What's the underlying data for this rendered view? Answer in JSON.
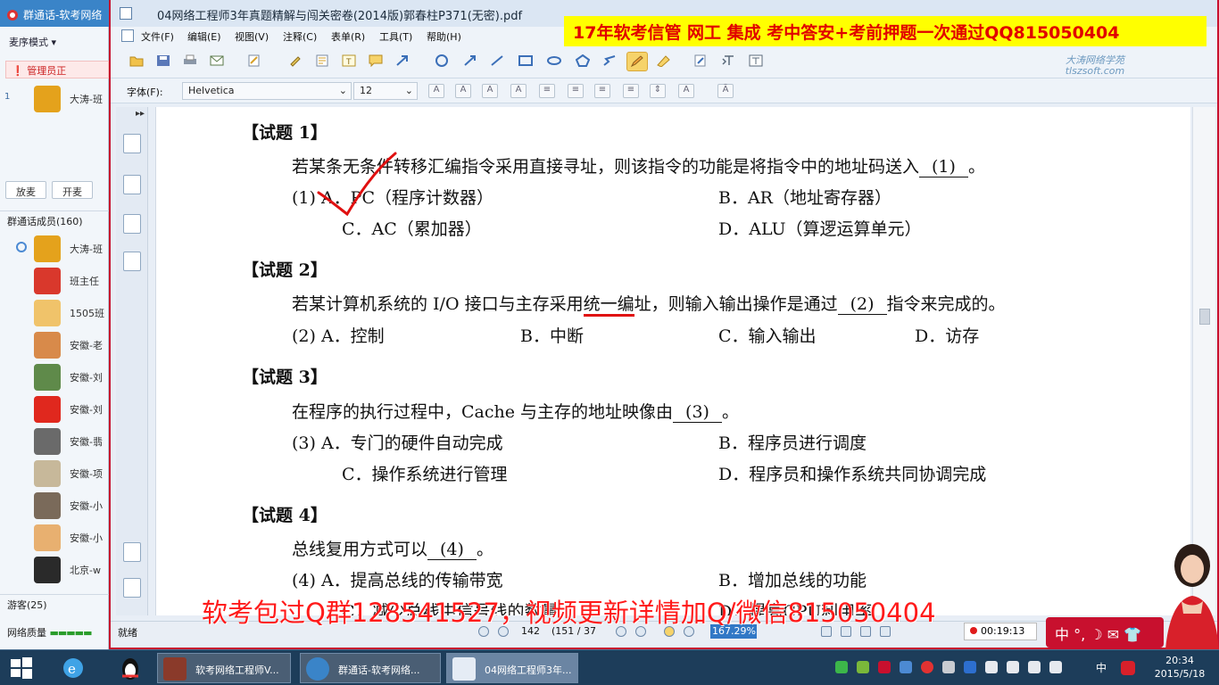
{
  "chat": {
    "title": "群通话-软考网络",
    "mode_label": "麦序模式",
    "admin_label": "管理员正",
    "top_user": {
      "index": "1",
      "name": "大涛-班"
    },
    "buttons": {
      "release": "放麦",
      "open": "开麦"
    },
    "members_label": "群通话成员(160)",
    "members": [
      {
        "name": "大涛-班"
      },
      {
        "name": "班主任"
      },
      {
        "name": "1505班"
      },
      {
        "name": "安徽-老"
      },
      {
        "name": "安徽-刘"
      },
      {
        "name": "安徽-刘"
      },
      {
        "name": "安徽-翡"
      },
      {
        "name": "安徽-项"
      },
      {
        "name": "安徽-小"
      },
      {
        "name": "安徽-小"
      },
      {
        "name": "北京-w"
      }
    ],
    "guests_label": "游客(25)",
    "network_label": "网络质量",
    "network_bars": "▬▬▬▬▬"
  },
  "pdf": {
    "window_title": "04网络工程师3年真题精解与闯关密卷(2014版)郭春柱P371(无密).pdf",
    "promo_top": "17年软考信管 网工 集成 考中答安+考前押题一次通过QQ815050404",
    "menu": [
      "文件(F)",
      "编辑(E)",
      "视图(V)",
      "注释(C)",
      "表单(R)",
      "工具(T)",
      "帮助(H)"
    ],
    "watermark_logo": "大涛网络学苑",
    "watermark_url": "tlszsoft.com",
    "font_label": "字体(F):",
    "font_name": "Helvetica",
    "font_size": "12",
    "questions": [
      {
        "head": "【试题 1】",
        "text": "若某条无条件转移汇编指令采用直接寻址，则该指令的功能是将指令中的地址码送入",
        "blank": "(1)",
        "tail": "。",
        "options": [
          {
            "label": "(1)  A．PC（程序计数器）"
          },
          {
            "label": "B．AR（地址寄存器）"
          },
          {
            "label": "C．AC（累加器）"
          },
          {
            "label": "D．ALU（算逻运算单元）"
          }
        ]
      },
      {
        "head": "【试题 2】",
        "text_before": "若某计算机系统的 I/O 接口与主存采用",
        "text_underlined": "统一编",
        "text_after": "址，则输入输出操作是通过",
        "blank": "(2)",
        "tail": "指令来完成的。",
        "options": [
          {
            "label": "(2)  A．控制"
          },
          {
            "label": "B．中断"
          },
          {
            "label": "C．输入输出"
          },
          {
            "label": "D．访存"
          }
        ]
      },
      {
        "head": "【试题 3】",
        "text": "在程序的执行过程中，Cache 与主存的地址映像由",
        "blank": "(3)",
        "tail": "。",
        "options": [
          {
            "label": "(3)  A．专门的硬件自动完成"
          },
          {
            "label": "B．程序员进行调度"
          },
          {
            "label": "C．操作系统进行管理"
          },
          {
            "label": "D．程序员和操作系统共同协调完成"
          }
        ]
      },
      {
        "head": "【试题 4】",
        "text": "总线复用方式可以",
        "blank": "(4)",
        "tail": "。",
        "options": [
          {
            "label": "(4)  A．提高总线的传输带宽"
          },
          {
            "label": "B．增加总线的功能"
          },
          {
            "label": "C．减少总线中信号线的数量"
          },
          {
            "label": "D．提高CPU利用率"
          }
        ]
      }
    ],
    "promo_bottom": "软考包过Q群128541527，视频更新详情加Q/微信815050404",
    "status": {
      "ready": "就绪",
      "page_num": "142",
      "page_of": "(151 / 37",
      "zoom": "167.29%"
    }
  },
  "recorder": {
    "time": "00:19:13"
  },
  "ime_bar": {
    "text": "中 °, ☽ ✉ 👕"
  },
  "taskbar": {
    "tasks": [
      {
        "label": "软考网络工程师V..."
      },
      {
        "label": "群通话-软考网络..."
      },
      {
        "label": "04网络工程师3年..."
      }
    ],
    "ime": "中",
    "time": "20:34",
    "date": "2015/5/18"
  },
  "colors": {
    "window_border": "#c8102e",
    "promo_yellow": "#ffff00",
    "promo_red": "#e10000",
    "taskbar": "#1d3d5a",
    "zoom_highlight": "#3178c6"
  }
}
